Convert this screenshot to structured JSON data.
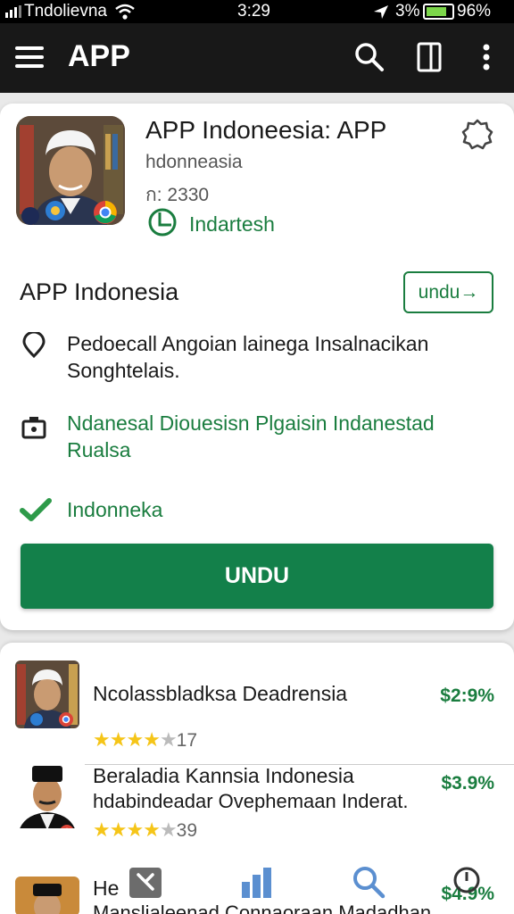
{
  "status_bar": {
    "carrier": "Tndolievna",
    "time": "3:29",
    "location_pct": "3%",
    "battery_pct": "96%",
    "battery_level": 0.82,
    "battery_color": "#7cd64a"
  },
  "app_bar": {
    "title": "APP",
    "icons": [
      "menu-icon",
      "search-icon",
      "tablet-icon",
      "more-vert-icon"
    ]
  },
  "app": {
    "name": "APP Indoneesia: APP",
    "subtitle": "hdonneasia",
    "meta": "ก: 2330",
    "developer": "Indartesh"
  },
  "details": {
    "section_title": "APP Indonesia",
    "undu_outline": "undu→",
    "location_text": "Pedoecall Angoian lainega Insalnacikan Songhtelais.",
    "camera_text": "Ndanesal Diouesisn Plgaisin Indanestad Rualsa",
    "check_text": "Indonneka",
    "primary_button": "UNDU"
  },
  "list": [
    {
      "name": "Ncolassbladksa Deadrensia",
      "price": "$2:9%",
      "stars": 4,
      "rating_count": "17"
    },
    {
      "name": "Beraladia Kannsia Indonesia",
      "subtitle": "hdabindeadar Ovephemaan Inderat.",
      "price": "$3.9%",
      "stars": 4,
      "rating_count": "39"
    },
    {
      "name": "He",
      "subtitle": "Manslialeenad Connaoraan Madadhan",
      "price": "$4.9%"
    }
  ],
  "colors": {
    "accent_green": "#1a7d3f",
    "button_green": "#13804a",
    "app_bar": "#181818",
    "star": "#f5c518"
  }
}
